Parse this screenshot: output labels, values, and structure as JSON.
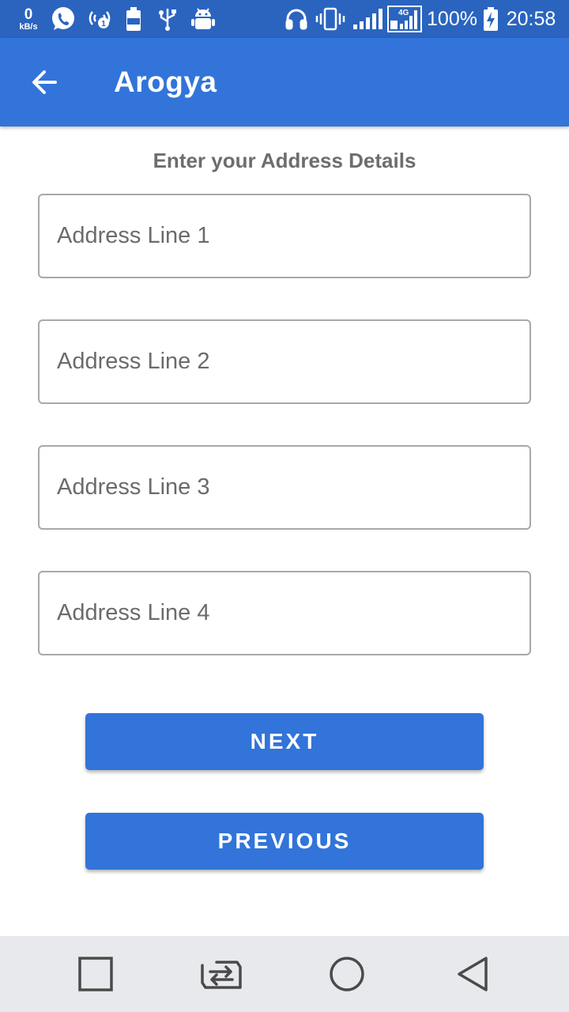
{
  "status_bar": {
    "net_speed_value": "0",
    "net_speed_unit": "kB/s",
    "notification_icons": [
      "whatsapp-icon",
      "hotspot-icon",
      "battery-saver-icon",
      "usb-icon",
      "android-debug-icon"
    ],
    "system_icons": [
      "headset-icon",
      "vibrate-icon",
      "signal-icon",
      "4g-signal-icon",
      "battery-charging-icon"
    ],
    "battery": "100%",
    "time": "20:58"
  },
  "app_bar": {
    "title": "Arogya",
    "back_icon": "arrow-back-icon"
  },
  "form": {
    "heading": "Enter your Address Details",
    "fields": [
      {
        "placeholder": "Address Line 1",
        "value": ""
      },
      {
        "placeholder": "Address Line 2",
        "value": ""
      },
      {
        "placeholder": "Address Line 3",
        "value": ""
      },
      {
        "placeholder": "Address Line 4",
        "value": ""
      }
    ],
    "next_label": "NEXT",
    "previous_label": "PREVIOUS"
  },
  "nav_bar": {
    "icons": [
      "recents-icon",
      "switch-apps-icon",
      "home-icon",
      "back-icon"
    ]
  },
  "colors": {
    "status_bar": "#2a64bf",
    "primary": "#3274d9",
    "field_border": "#a8a8a8",
    "heading_text": "#6d6d6d",
    "nav_bar": "#e8e9ec"
  }
}
